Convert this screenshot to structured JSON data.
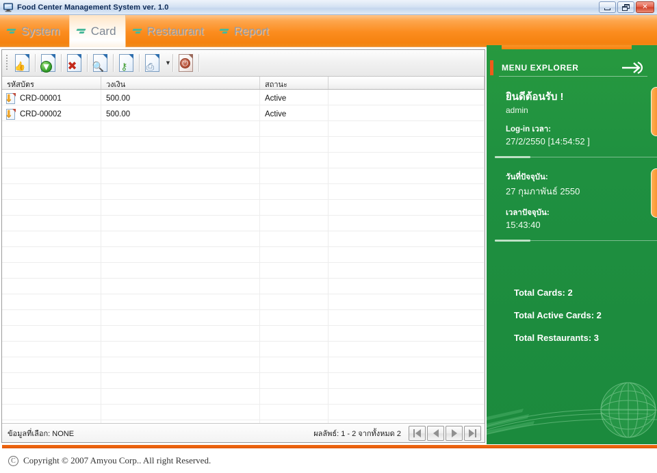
{
  "window": {
    "title": "Food Center Management System ver. 1.0",
    "icon": "monitor-icon",
    "minimize_label": "Minimize",
    "restore_label": "Restore",
    "close_label": "Close",
    "close_glyph": "✕"
  },
  "nav": {
    "tabs": [
      {
        "label": "System",
        "active": false,
        "icon": "chevron-icon"
      },
      {
        "label": "Card",
        "active": true,
        "icon": "chevron-icon"
      },
      {
        "label": "Restaurant",
        "active": false,
        "icon": "chevron-icon"
      },
      {
        "label": "Report",
        "active": false,
        "icon": "chevron-icon"
      }
    ]
  },
  "toolbar": {
    "buttons": [
      {
        "name": "new-card-button",
        "icon": "document-thumbs-up-icon",
        "glyph": "👍",
        "style": "thumb"
      },
      {
        "name": "save-card-button",
        "icon": "document-download-icon",
        "glyph": "▼",
        "style": "green"
      },
      {
        "name": "delete-card-button",
        "icon": "document-delete-icon",
        "glyph": "✖",
        "style": "red-x"
      },
      {
        "name": "search-card-button",
        "icon": "document-search-icon",
        "glyph": "🔍",
        "style": "mag"
      },
      {
        "name": "permission-button",
        "icon": "document-key-icon",
        "glyph": "⚷",
        "style": "key"
      },
      {
        "name": "print-button",
        "icon": "document-print-icon",
        "glyph": "⎙",
        "style": "print"
      },
      {
        "name": "exit-button",
        "icon": "document-power-icon",
        "glyph": "⏻",
        "style": "power"
      }
    ],
    "print_dropdown_glyph": "▼"
  },
  "grid": {
    "columns": [
      "รหัสบัตร",
      "วงเงิน",
      "สถานะ",
      ""
    ],
    "rows": [
      {
        "code": "CRD-00001",
        "amount": "500.00",
        "status": "Active"
      },
      {
        "code": "CRD-00002",
        "amount": "500.00",
        "status": "Active"
      }
    ],
    "empty_row_count": 20,
    "row_icon": "card-row-icon"
  },
  "status": {
    "selected_label": "ข้อมูลที่เลือก: NONE",
    "result_label": "ผลลัพธ์: 1 - 2 จากทั้งหมด 2",
    "pager": [
      {
        "name": "first-page-button",
        "icon": "first-page-icon"
      },
      {
        "name": "prev-page-button",
        "icon": "prev-page-icon"
      },
      {
        "name": "next-page-button",
        "icon": "next-page-icon"
      },
      {
        "name": "last-page-button",
        "icon": "last-page-icon"
      }
    ]
  },
  "explorer": {
    "title": "MENU EXPLORER",
    "arrow_icon": "arrow-right-icon",
    "welcome": "ยินดีต้อนรับ !",
    "user": "admin",
    "login_time_label": "Log-in เวลา:",
    "login_time_value": "27/2/2550 [14:54:52 ]",
    "current_date_label": "วันที่ปัจจุบัน:",
    "current_date_value": "27 กุมภาพันธ์ 2550",
    "current_time_label": "เวลาปัจจุบัน:",
    "current_time_value": "15:43:40",
    "stats": [
      "Total Cards: 2",
      "Total Active Cards: 2",
      "Total Restaurants: 3"
    ]
  },
  "footer": {
    "copyright_symbol": "C",
    "copyright": "Copyright © 2007 Amyou Corp.. All right Reserved."
  },
  "colors": {
    "orange": "#f6830f",
    "green": "#1f9040",
    "accent_red": "#ef5b1a"
  }
}
